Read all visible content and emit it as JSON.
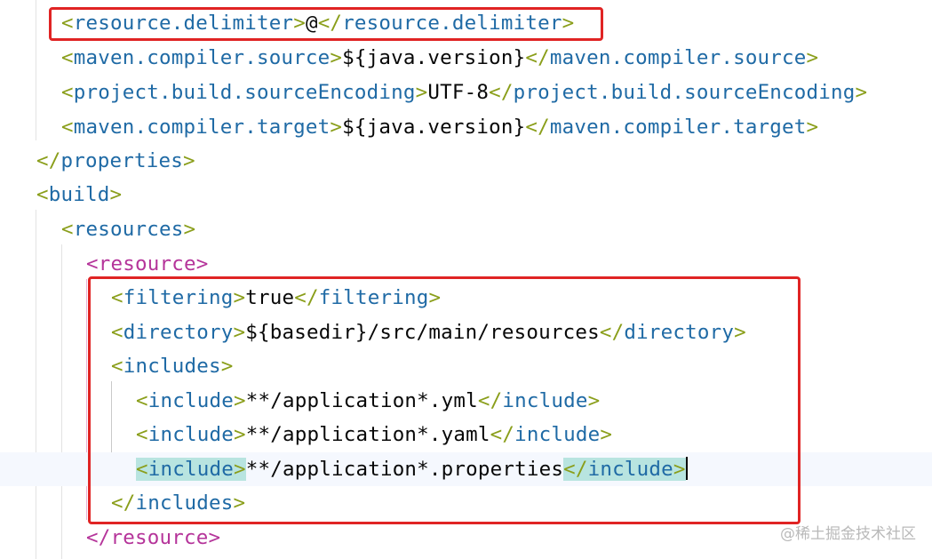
{
  "lines": [
    {
      "tag": "resource.delimiter",
      "value": "@"
    },
    {
      "tag": "maven.compiler.source",
      "value": "${java.version}"
    },
    {
      "tag": "project.build.sourceEncoding",
      "value": "UTF-8"
    },
    {
      "tag": "maven.compiler.target",
      "value": "${java.version}"
    },
    {
      "close_tag": "properties"
    },
    {
      "open_tag": "build"
    },
    {
      "open_tag": "resources"
    },
    {
      "open_tag": "resource"
    },
    {
      "tag": "filtering",
      "value": "true"
    },
    {
      "tag": "directory",
      "value": "${basedir}/src/main/resources"
    },
    {
      "open_tag": "includes"
    },
    {
      "tag": "include",
      "value": "**/application*.yml"
    },
    {
      "tag": "include",
      "value": "**/application*.yaml"
    },
    {
      "tag": "include",
      "value": "**/application*.properties"
    },
    {
      "close_tag": "includes"
    },
    {
      "close_tag": "resource"
    }
  ],
  "watermark": "@稀土掘金技术社区"
}
